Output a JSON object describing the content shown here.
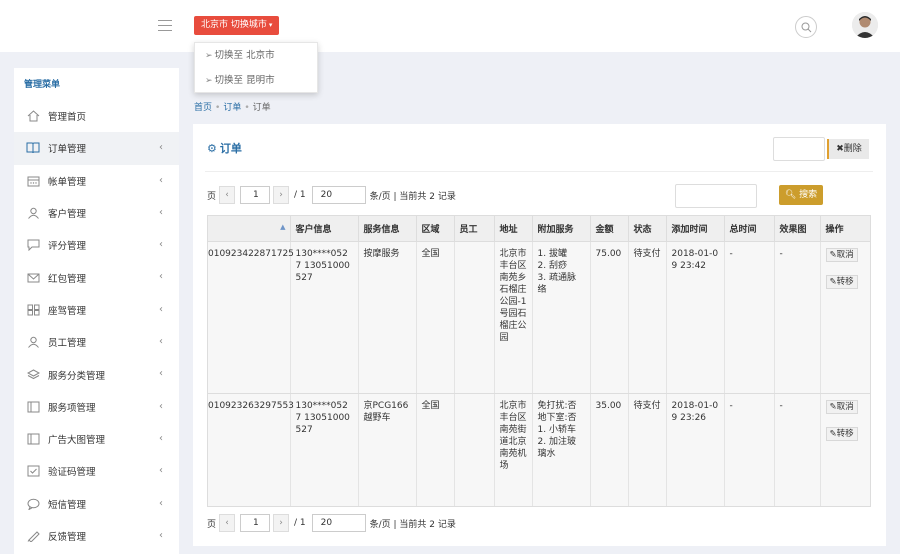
{
  "header": {
    "city_button_label": "北京市 切换城市",
    "city_dropdown": [
      {
        "label": "切换至 北京市"
      },
      {
        "label": "切换至 昆明市"
      }
    ]
  },
  "sidebar": {
    "title": "管理菜单",
    "items": [
      {
        "label": "管理首页",
        "icon": "home-icon",
        "has_chevron": false
      },
      {
        "label": "订单管理",
        "icon": "book-icon",
        "has_chevron": true,
        "active": true
      },
      {
        "label": "帐单管理",
        "icon": "calendar-icon",
        "has_chevron": true
      },
      {
        "label": "客户管理",
        "icon": "user-icon",
        "has_chevron": true
      },
      {
        "label": "评分管理",
        "icon": "comment-icon",
        "has_chevron": true
      },
      {
        "label": "红包管理",
        "icon": "envelope-icon",
        "has_chevron": true
      },
      {
        "label": "座驾管理",
        "icon": "grid-icon",
        "has_chevron": true
      },
      {
        "label": "员工管理",
        "icon": "user-icon",
        "has_chevron": true
      },
      {
        "label": "服务分类管理",
        "icon": "layers-icon",
        "has_chevron": true
      },
      {
        "label": "服务项管理",
        "icon": "list-icon",
        "has_chevron": true
      },
      {
        "label": "广告大图管理",
        "icon": "list-icon",
        "has_chevron": true
      },
      {
        "label": "验证码管理",
        "icon": "check-icon",
        "has_chevron": true
      },
      {
        "label": "短信管理",
        "icon": "chat-icon",
        "has_chevron": true
      },
      {
        "label": "反馈管理",
        "icon": "feedback-icon",
        "has_chevron": true
      }
    ]
  },
  "breadcrumb": {
    "home": "首页",
    "current_link": "订单",
    "current": "订单"
  },
  "panel": {
    "title": "订单",
    "delete_label": "删除",
    "search_label": "搜索",
    "pager": {
      "prefix": "页",
      "prev": "‹",
      "page": "1",
      "next": "›",
      "total_pages": "/ 1",
      "page_size": "20",
      "info": "条/页 | 当前共 2 记录"
    }
  },
  "table": {
    "columns": [
      "",
      "客户信息",
      "服务信息",
      "区域",
      "员工",
      "地址",
      "附加服务",
      "金额",
      "状态",
      "添加时间",
      "总时间",
      "效果图",
      "操作"
    ],
    "rows": [
      {
        "order_id": "010923422871725",
        "customer": "130****0527 13051000527",
        "service": "按摩服务",
        "region": "全国",
        "staff": "",
        "address": "北京市丰台区南苑乡石榴庄公园-1号园石榴庄公园",
        "extra": [
          "1. 拔罐",
          "2. 刮痧",
          "3. 疏通脉络"
        ],
        "amount": "75.00",
        "status": "待支付",
        "added": "2018-01-09 23:42",
        "total_time": "-",
        "effect": "-",
        "actions": [
          "取消",
          "转移"
        ]
      },
      {
        "order_id": "010923263297553",
        "customer": "130****0527 13051000527",
        "service": "京PCG166越野车",
        "region": "全国",
        "staff": "",
        "address": "北京市丰台区南苑街道北京南苑机场",
        "extra": [
          "免打扰:否",
          "地下室:否",
          "1. 小轿车",
          "2. 加注玻璃水"
        ],
        "amount": "35.00",
        "status": "待支付",
        "added": "2018-01-09 23:26",
        "total_time": "-",
        "effect": "-",
        "actions": [
          "取消",
          "转移"
        ]
      }
    ]
  }
}
